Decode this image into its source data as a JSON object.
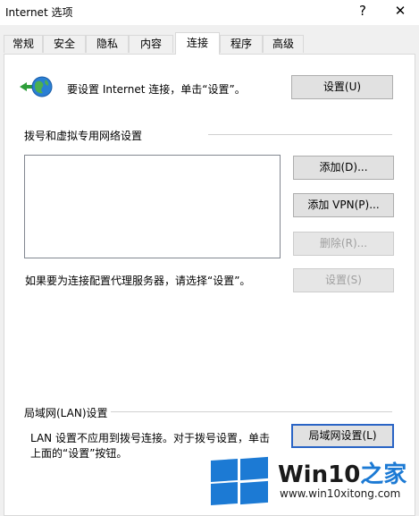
{
  "window": {
    "title": "Internet 选项",
    "help_symbol": "?",
    "close_symbol": "✕"
  },
  "tabs": [
    {
      "label": "常规"
    },
    {
      "label": "安全"
    },
    {
      "label": "隐私"
    },
    {
      "label": "内容"
    },
    {
      "label": "连接",
      "active": true
    },
    {
      "label": "程序"
    },
    {
      "label": "高级"
    }
  ],
  "setup": {
    "text": "要设置 Internet 连接，单击“设置”。",
    "button": "设置(U)"
  },
  "dialup": {
    "header": "拨号和虚拟专用网络设置",
    "add_button": "添加(D)...",
    "add_vpn_button": "添加 VPN(P)...",
    "remove_button": "删除(R)...",
    "proxy_text": "如果要为连接配置代理服务器，请选择“设置”。",
    "settings_button": "设置(S)"
  },
  "lan": {
    "header": "局域网(LAN)设置",
    "text_line1": "LAN 设置不应用到拨号连接。对于拨号设置，单击",
    "text_line2": "上面的“设置”按钮。",
    "button": "局域网设置(L)"
  },
  "watermark": {
    "brand_a": "Win10",
    "brand_b": "之家",
    "url": "www.win10xitong.com"
  },
  "colors": {
    "accent": "#1c7ad4",
    "focus": "#2a64c5"
  }
}
